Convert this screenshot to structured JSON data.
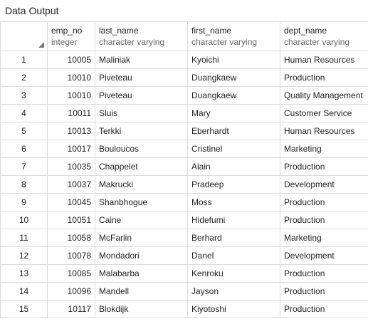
{
  "panel": {
    "title": "Data Output"
  },
  "columns": [
    {
      "name": "emp_no",
      "type": "integer"
    },
    {
      "name": "last_name",
      "type": "character varying"
    },
    {
      "name": "first_name",
      "type": "character varying"
    },
    {
      "name": "dept_name",
      "type": "character varying"
    }
  ],
  "rows": [
    {
      "n": "1",
      "emp_no": "10005",
      "last_name": "Maliniak",
      "first_name": "Kyoichi",
      "dept_name": "Human Resources"
    },
    {
      "n": "2",
      "emp_no": "10010",
      "last_name": "Piveteau",
      "first_name": "Duangkaew",
      "dept_name": "Production"
    },
    {
      "n": "3",
      "emp_no": "10010",
      "last_name": "Piveteau",
      "first_name": "Duangkaew",
      "dept_name": "Quality Management"
    },
    {
      "n": "4",
      "emp_no": "10011",
      "last_name": "Sluis",
      "first_name": "Mary",
      "dept_name": "Customer Service"
    },
    {
      "n": "5",
      "emp_no": "10013",
      "last_name": "Terkki",
      "first_name": "Eberhardt",
      "dept_name": "Human Resources"
    },
    {
      "n": "6",
      "emp_no": "10017",
      "last_name": "Bouloucos",
      "first_name": "Cristinel",
      "dept_name": "Marketing"
    },
    {
      "n": "7",
      "emp_no": "10035",
      "last_name": "Chappelet",
      "first_name": "Alain",
      "dept_name": "Production"
    },
    {
      "n": "8",
      "emp_no": "10037",
      "last_name": "Makrucki",
      "first_name": "Pradeep",
      "dept_name": "Development"
    },
    {
      "n": "9",
      "emp_no": "10045",
      "last_name": "Shanbhogue",
      "first_name": "Moss",
      "dept_name": "Production"
    },
    {
      "n": "10",
      "emp_no": "10051",
      "last_name": "Caine",
      "first_name": "Hidefumi",
      "dept_name": "Production"
    },
    {
      "n": "11",
      "emp_no": "10058",
      "last_name": "McFarlin",
      "first_name": "Berhard",
      "dept_name": "Marketing"
    },
    {
      "n": "12",
      "emp_no": "10078",
      "last_name": "Mondadori",
      "first_name": "Danel",
      "dept_name": "Development"
    },
    {
      "n": "13",
      "emp_no": "10085",
      "last_name": "Malabarba",
      "first_name": "Kenroku",
      "dept_name": "Production"
    },
    {
      "n": "14",
      "emp_no": "10096",
      "last_name": "Mandell",
      "first_name": "Jayson",
      "dept_name": "Production"
    },
    {
      "n": "15",
      "emp_no": "10117",
      "last_name": "Blokdijk",
      "first_name": "Kiyotoshi",
      "dept_name": "Production"
    }
  ]
}
